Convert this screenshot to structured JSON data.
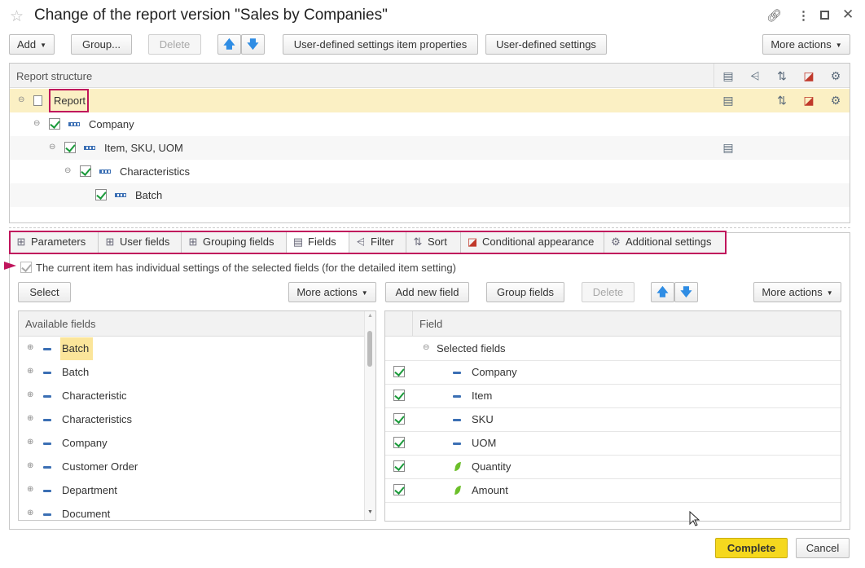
{
  "window": {
    "title": "Change of the report version \"Sales by Companies\"",
    "icons": [
      "star-icon",
      "link-icon",
      "kebab-icon",
      "maximize-icon",
      "close-icon"
    ]
  },
  "toolbar": {
    "add": "Add",
    "group": "Group...",
    "delete": "Delete",
    "item_props": "User-defined settings item properties",
    "user_settings": "User-defined settings",
    "more_actions": "More actions"
  },
  "structure": {
    "header": "Report structure",
    "rows": [
      {
        "label": "Report"
      },
      {
        "label": "Company"
      },
      {
        "label": "Item, SKU, UOM"
      },
      {
        "label": "Characteristics"
      },
      {
        "label": "Batch"
      }
    ]
  },
  "tabs": [
    {
      "label": "Parameters"
    },
    {
      "label": "User fields"
    },
    {
      "label": "Grouping fields"
    },
    {
      "label": "Fields"
    },
    {
      "label": "Filter"
    },
    {
      "label": "Sort"
    },
    {
      "label": "Conditional appearance"
    },
    {
      "label": "Additional settings"
    }
  ],
  "individual_settings": {
    "label": "The current item has individual settings of the selected fields (for the detailed item setting)",
    "checked": true
  },
  "left_panel": {
    "select": "Select",
    "more_actions": "More actions",
    "header": "Available fields",
    "items": [
      "Batch",
      "Batch",
      "Characteristic",
      "Characteristics",
      "Company",
      "Customer Order",
      "Department",
      "Document"
    ]
  },
  "right_panel": {
    "add_field": "Add new field",
    "group_fields": "Group fields",
    "delete": "Delete",
    "more_actions": "More actions",
    "header": "Field",
    "group_label": "Selected fields",
    "fields": [
      "Company",
      "Item",
      "SKU",
      "UOM",
      "Quantity",
      "Amount"
    ]
  },
  "footer": {
    "complete": "Complete",
    "cancel": "Cancel"
  },
  "colors": {
    "accent_yellow": "#f5d81e",
    "highlight_red": "#c0155c",
    "selected_row": "#fbf0c4"
  }
}
